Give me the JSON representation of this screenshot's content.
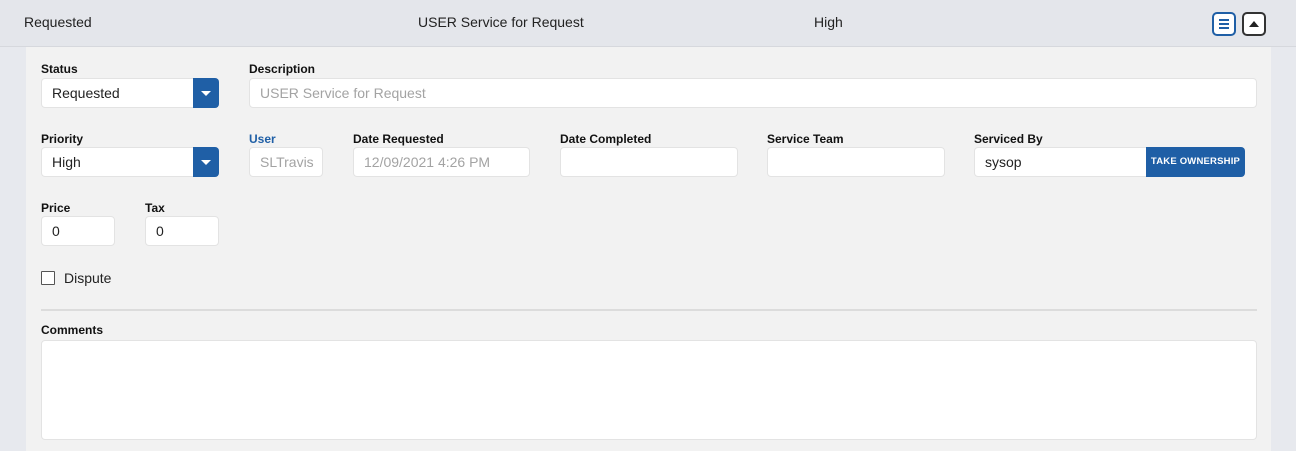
{
  "header": {
    "status": "Requested",
    "description": "USER Service for Request",
    "priority": "High"
  },
  "form": {
    "status": {
      "label": "Status",
      "value": "Requested"
    },
    "description": {
      "label": "Description",
      "value": "USER Service for Request"
    },
    "priority": {
      "label": "Priority",
      "value": "High"
    },
    "user": {
      "label": "User",
      "value": "SLTravis"
    },
    "date_requested": {
      "label": "Date Requested",
      "value": "12/09/2021 4:26 PM"
    },
    "date_completed": {
      "label": "Date Completed",
      "value": ""
    },
    "service_team": {
      "label": "Service Team",
      "value": ""
    },
    "serviced_by": {
      "label": "Serviced By",
      "value": "sysop",
      "button": "TAKE OWNERSHIP"
    },
    "price": {
      "label": "Price",
      "value": "0"
    },
    "tax": {
      "label": "Tax",
      "value": "0"
    },
    "dispute": {
      "label": "Dispute",
      "checked": false
    },
    "comments": {
      "label": "Comments",
      "value": ""
    }
  },
  "colors": {
    "accent": "#1f5fa6",
    "panel": "#f2f2f2",
    "background": "#e7e9ee"
  }
}
